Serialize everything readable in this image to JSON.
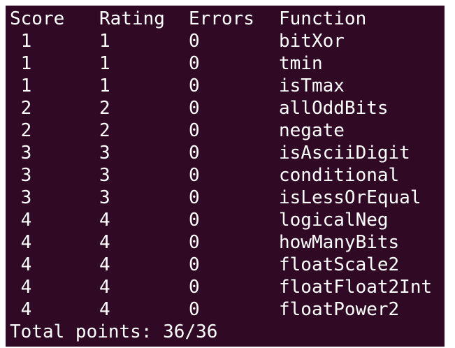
{
  "terminal": {
    "headers": {
      "score": "Score",
      "rating": "Rating",
      "errors": "Errors",
      "function": "Function"
    },
    "rows": [
      {
        "score": " 1",
        "rating": "1",
        "errors": "0",
        "function": "bitXor"
      },
      {
        "score": " 1",
        "rating": "1",
        "errors": "0",
        "function": "tmin"
      },
      {
        "score": " 1",
        "rating": "1",
        "errors": "0",
        "function": "isTmax"
      },
      {
        "score": " 2",
        "rating": "2",
        "errors": "0",
        "function": "allOddBits"
      },
      {
        "score": " 2",
        "rating": "2",
        "errors": "0",
        "function": "negate"
      },
      {
        "score": " 3",
        "rating": "3",
        "errors": "0",
        "function": "isAsciiDigit"
      },
      {
        "score": " 3",
        "rating": "3",
        "errors": "0",
        "function": "conditional"
      },
      {
        "score": " 3",
        "rating": "3",
        "errors": "0",
        "function": "isLessOrEqual"
      },
      {
        "score": " 4",
        "rating": "4",
        "errors": "0",
        "function": "logicalNeg"
      },
      {
        "score": " 4",
        "rating": "4",
        "errors": "0",
        "function": "howManyBits"
      },
      {
        "score": " 4",
        "rating": "4",
        "errors": "0",
        "function": "floatScale2"
      },
      {
        "score": " 4",
        "rating": "4",
        "errors": "0",
        "function": "floatFloat2Int"
      },
      {
        "score": " 4",
        "rating": "4",
        "errors": "0",
        "function": "floatPower2"
      }
    ],
    "total": "Total points: 36/36",
    "colors": {
      "background": "#300a24",
      "text": "#ffffff"
    }
  }
}
